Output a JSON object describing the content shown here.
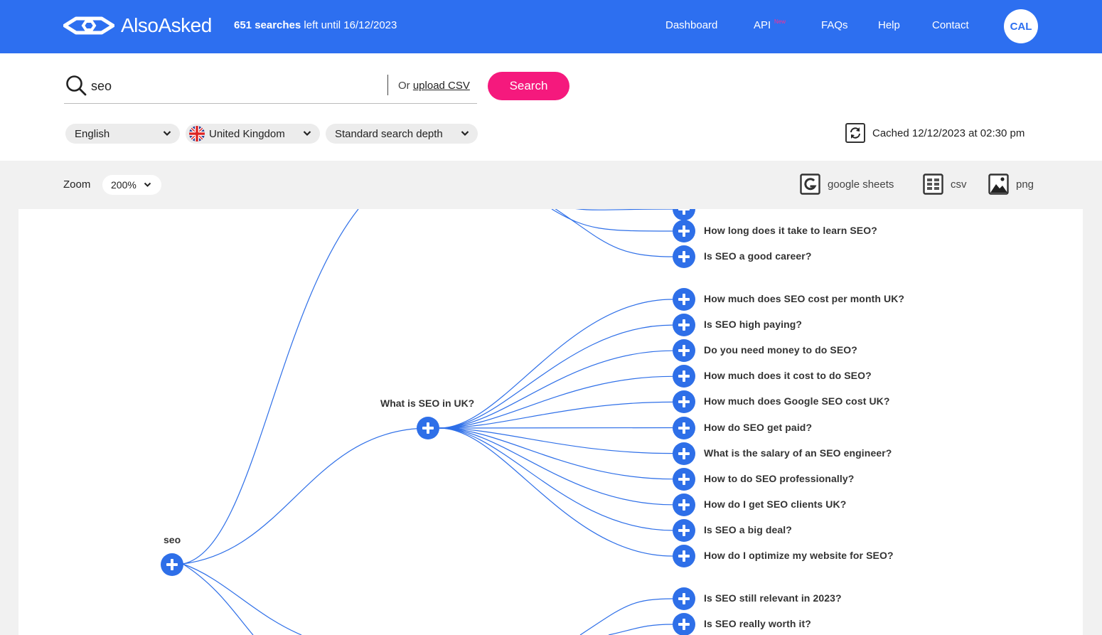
{
  "header": {
    "brand": "AlsoAsked",
    "quota_count": "651 searches",
    "quota_rest": " left until 16/12/2023",
    "nav": [
      {
        "label": "Dashboard"
      },
      {
        "label": "API"
      },
      {
        "label": "FAQs"
      },
      {
        "label": "Help"
      },
      {
        "label": "Contact"
      }
    ],
    "api_badge": "New",
    "avatar_initials": "CAL",
    "brand_color": "#2d6ff0"
  },
  "search": {
    "query": "seo",
    "or_text": "Or ",
    "upload_link": "upload CSV",
    "button_label": "Search",
    "button_color": "#f5197d"
  },
  "filters": {
    "language": "English",
    "region": "United Kingdom",
    "depth": "Standard search depth"
  },
  "cache": {
    "text": "Cached 12/12/2023 at 02:30 pm"
  },
  "toolbar": {
    "zoom_label": "Zoom",
    "zoom_value": "200%",
    "exports": [
      {
        "label": "google sheets",
        "icon": "google-sheets-icon"
      },
      {
        "label": "csv",
        "icon": "csv-icon"
      },
      {
        "label": "png",
        "icon": "image-icon"
      }
    ]
  },
  "tree": {
    "root": "seo",
    "branch": "What is SEO in UK?",
    "top_questions": [
      "How long does it take to learn SEO?",
      "Is SEO a good career?"
    ],
    "branch_questions": [
      "How much does SEO cost per month UK?",
      "Is SEO high paying?",
      "Do you need money to do SEO?",
      "How much does it cost to do SEO?",
      "How much does Google SEO cost UK?",
      "How do SEO get paid?",
      "What is the salary of an SEO engineer?",
      "How to do SEO professionally?",
      "How do I get SEO clients UK?",
      "Is SEO a big deal?",
      "How do I optimize my website for SEO?"
    ],
    "bottom_questions": [
      "Is SEO still relevant in 2023?",
      "Is SEO really worth it?"
    ]
  }
}
